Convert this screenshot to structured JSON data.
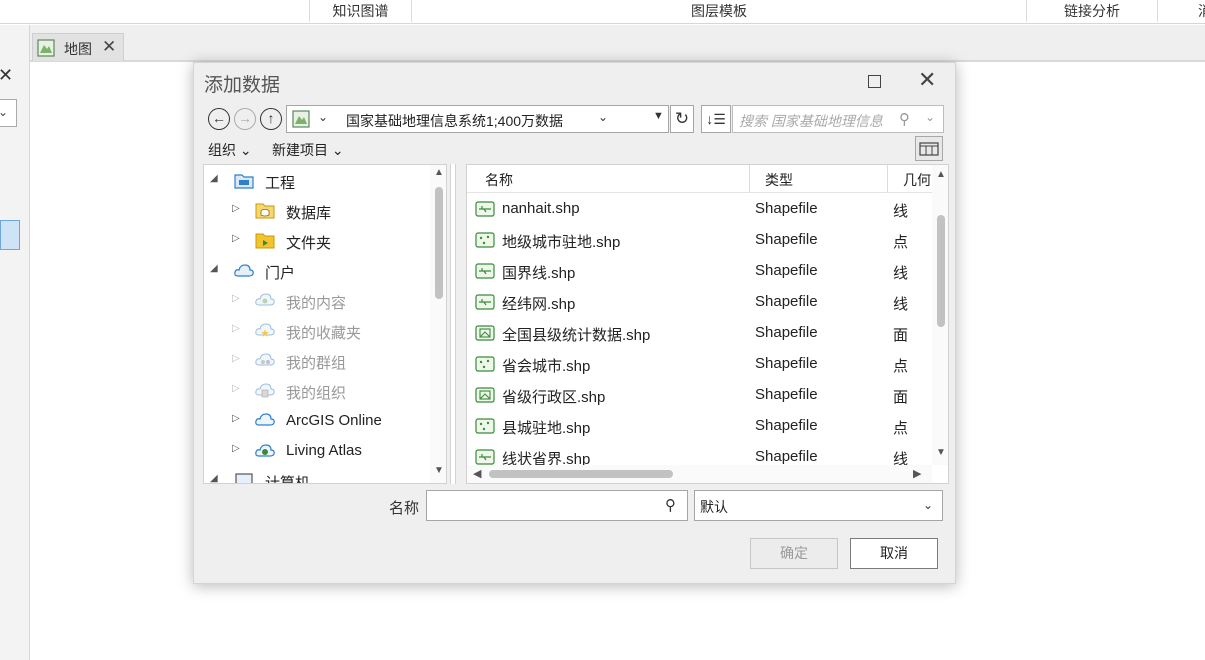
{
  "ribbon": {
    "groups": [
      "知识图谱",
      "图层模板",
      "链接分析",
      "消"
    ]
  },
  "left_pane": {
    "close_glyph": "✕",
    "combo_glyph": "⌄"
  },
  "map_tab": {
    "label": "地图",
    "close_glyph": "✕"
  },
  "dialog": {
    "title": "添加数据",
    "close_glyph": "✕",
    "nav": {
      "back_glyph": "←",
      "forward_glyph": "→",
      "up_glyph": "↑",
      "path": "国家基础地理信息系统1;400万数据",
      "refresh_glyph": "↻",
      "sort_glyph": "↓☰"
    },
    "search": {
      "placeholder": "搜索 国家基础地理信息",
      "icon": "⚲"
    },
    "menus": {
      "organize": "组织 ⌄",
      "new_item": "新建项目 ⌄"
    },
    "tree": [
      {
        "label": "工程",
        "icon": "project-icon",
        "expanded": true,
        "dim": false
      },
      {
        "label": "数据库",
        "icon": "database-icon",
        "expanded": false,
        "dim": false
      },
      {
        "label": "文件夹",
        "icon": "folder-icon",
        "expanded": false,
        "dim": false
      },
      {
        "label": "门户",
        "icon": "portal-cloud-icon",
        "expanded": true,
        "dim": false
      },
      {
        "label": "我的内容",
        "icon": "my-content-icon",
        "expanded": false,
        "dim": true
      },
      {
        "label": "我的收藏夹",
        "icon": "favorites-icon",
        "expanded": false,
        "dim": true
      },
      {
        "label": "我的群组",
        "icon": "groups-icon",
        "expanded": false,
        "dim": true
      },
      {
        "label": "我的组织",
        "icon": "organization-icon",
        "expanded": false,
        "dim": true
      },
      {
        "label": "ArcGIS Online",
        "icon": "arcgis-online-icon",
        "expanded": false,
        "dim": false
      },
      {
        "label": "Living Atlas",
        "icon": "living-atlas-icon",
        "expanded": false,
        "dim": false
      },
      {
        "label": "计算机",
        "icon": "computer-icon",
        "expanded": true,
        "dim": false
      }
    ],
    "columns": {
      "name": "名称",
      "type": "类型",
      "geometry": "几何"
    },
    "files": [
      {
        "name": "nanhait.shp",
        "type": "Shapefile",
        "geometry": "线",
        "icon": "line-shapefile-icon"
      },
      {
        "name": "地级城市驻地.shp",
        "type": "Shapefile",
        "geometry": "点",
        "icon": "point-shapefile-icon"
      },
      {
        "name": "国界线.shp",
        "type": "Shapefile",
        "geometry": "线",
        "icon": "line-shapefile-icon"
      },
      {
        "name": "经纬网.shp",
        "type": "Shapefile",
        "geometry": "线",
        "icon": "line-shapefile-icon"
      },
      {
        "name": "全国县级统计数据.shp",
        "type": "Shapefile",
        "geometry": "面",
        "icon": "polygon-shapefile-icon"
      },
      {
        "name": "省会城市.shp",
        "type": "Shapefile",
        "geometry": "点",
        "icon": "point-shapefile-icon"
      },
      {
        "name": "省级行政区.shp",
        "type": "Shapefile",
        "geometry": "面",
        "icon": "polygon-shapefile-icon"
      },
      {
        "name": "县城驻地.shp",
        "type": "Shapefile",
        "geometry": "点",
        "icon": "point-shapefile-icon"
      },
      {
        "name": "线状省界.shp",
        "type": "Shapefile",
        "geometry": "线",
        "icon": "line-shapefile-icon"
      }
    ],
    "name_field": {
      "label": "名称",
      "value": ""
    },
    "filter": {
      "selected": "默认"
    },
    "buttons": {
      "ok": "确定",
      "cancel": "取消"
    }
  },
  "colors": {
    "dialog_bg": "#efefef",
    "shapefile_icon": "#3a8a3a",
    "folder_icon": "#e6b800",
    "portal_icon": "#2f7fc9"
  }
}
